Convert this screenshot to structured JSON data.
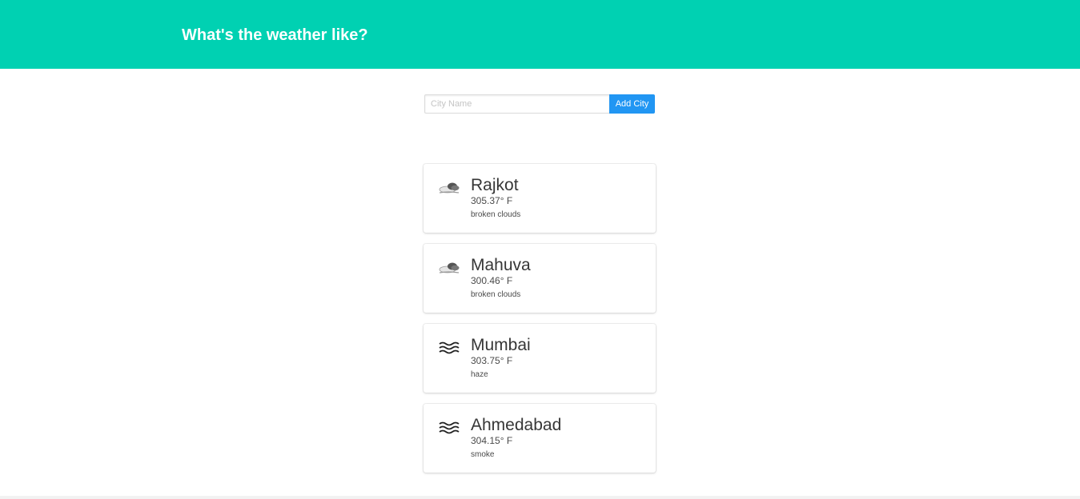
{
  "header": {
    "title": "What's the weather like?",
    "background": "#00d1b2"
  },
  "form": {
    "placeholder": "City Name",
    "value": "",
    "button_label": "Add City",
    "button_color": "#2196f3"
  },
  "cities": [
    {
      "name": "Rajkot",
      "temp": "305.37° F",
      "description": "broken clouds",
      "icon": "broken-clouds-icon"
    },
    {
      "name": "Mahuva",
      "temp": "300.46° F",
      "description": "broken clouds",
      "icon": "broken-clouds-icon"
    },
    {
      "name": "Mumbai",
      "temp": "303.75° F",
      "description": "haze",
      "icon": "haze-icon"
    },
    {
      "name": "Ahmedabad",
      "temp": "304.15° F",
      "description": "smoke",
      "icon": "haze-icon"
    }
  ]
}
